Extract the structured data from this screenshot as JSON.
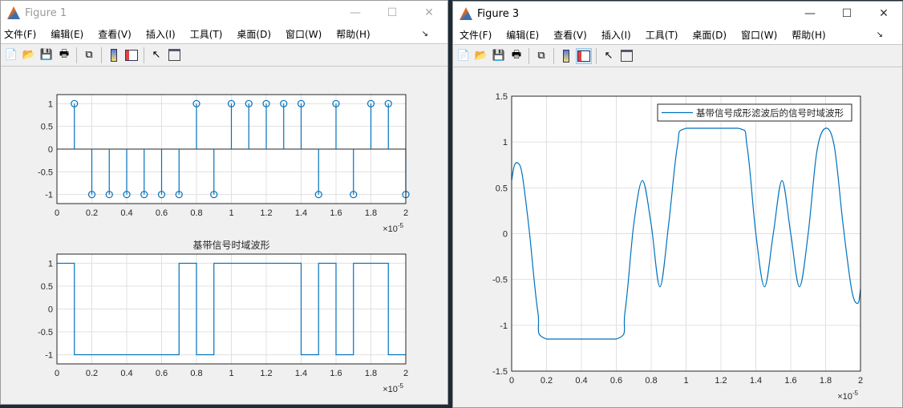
{
  "figure1": {
    "title": "Figure 1",
    "window_buttons": [
      "—",
      "☐",
      "✕"
    ],
    "menu": [
      "文件(F)",
      "编辑(E)",
      "查看(V)",
      "插入(I)",
      "工具(T)",
      "桌面(D)",
      "窗口(W)",
      "帮助(H)"
    ],
    "toolbar": [
      "new-icon",
      "open-icon",
      "save-icon",
      "print-icon",
      "link-icon",
      "colorbar-icon",
      "legend-icon",
      "pointer-icon",
      "property-editor-icon"
    ]
  },
  "figure3": {
    "title": "Figure 3",
    "window_buttons": [
      "—",
      "☐",
      "✕"
    ],
    "menu": [
      "文件(F)",
      "编辑(E)",
      "查看(V)",
      "插入(I)",
      "工具(T)",
      "桌面(D)",
      "窗口(W)",
      "帮助(H)"
    ],
    "toolbar": [
      "new-icon",
      "open-icon",
      "save-icon",
      "print-icon",
      "link-icon",
      "colorbar-icon",
      "legend-icon",
      "pointer-icon",
      "property-editor-icon"
    ]
  },
  "chart_data": [
    {
      "type": "stem",
      "title": "",
      "x": [
        0.1,
        0.2,
        0.3,
        0.4,
        0.5,
        0.6,
        0.7,
        0.8,
        0.9,
        1.0,
        1.1,
        1.2,
        1.3,
        1.4,
        1.5,
        1.6,
        1.7,
        1.8,
        1.9,
        2.0
      ],
      "y": [
        1,
        -1,
        -1,
        -1,
        -1,
        -1,
        -1,
        1,
        -1,
        1,
        1,
        1,
        1,
        1,
        -1,
        1,
        -1,
        1,
        1,
        -1
      ],
      "xlim": [
        0,
        2
      ],
      "ylim": [
        -1.2,
        1.2
      ],
      "xticks": [
        "0",
        "0.2",
        "0.4",
        "0.6",
        "0.8",
        "1",
        "1.2",
        "1.4",
        "1.6",
        "1.8",
        "2"
      ],
      "yticks": [
        "-1",
        "-0.5",
        "0",
        "0.5",
        "1"
      ],
      "xexp": "×10",
      "xexp_power": "-5",
      "grid": true,
      "color": "#0072bd"
    },
    {
      "type": "line",
      "title": "基带信号时域波形",
      "x": [
        0,
        0.1,
        0.1,
        0.7,
        0.7,
        0.8,
        0.8,
        0.9,
        0.9,
        1.4,
        1.4,
        1.5,
        1.5,
        1.6,
        1.6,
        1.7,
        1.7,
        1.9,
        1.9,
        2.0
      ],
      "y": [
        1,
        1,
        -1,
        -1,
        1,
        1,
        -1,
        -1,
        1,
        1,
        -1,
        -1,
        1,
        1,
        -1,
        -1,
        1,
        1,
        -1,
        -1
      ],
      "xlim": [
        0,
        2
      ],
      "ylim": [
        -1.2,
        1.2
      ],
      "xticks": [
        "0",
        "0.2",
        "0.4",
        "0.6",
        "0.8",
        "1",
        "1.2",
        "1.4",
        "1.6",
        "1.8",
        "2"
      ],
      "yticks": [
        "-1",
        "-0.5",
        "0",
        "0.5",
        "1"
      ],
      "xexp": "×10",
      "xexp_power": "-5",
      "grid": true,
      "color": "#0072bd"
    },
    {
      "type": "line",
      "title": "",
      "legend": "基带信号成形滤波后的信号时域波形",
      "legend_position": "top-right",
      "x": [
        0,
        0.015,
        0.035,
        0.06,
        0.1,
        0.15,
        0.2,
        0.6,
        0.65,
        0.7,
        0.75,
        0.8,
        0.85,
        0.9,
        0.95,
        1.0,
        1.3,
        1.35,
        1.4,
        1.45,
        1.5,
        1.55,
        1.6,
        1.65,
        1.7,
        1.75,
        1.8,
        1.85,
        1.9,
        1.95,
        1.985,
        2.0
      ],
      "y": [
        0.58,
        0.74,
        0.77,
        0.65,
        0.05,
        -0.85,
        -1.15,
        -1.15,
        -0.85,
        0.1,
        0.58,
        0.1,
        -0.58,
        0.1,
        0.95,
        1.15,
        1.15,
        0.95,
        0.0,
        -0.58,
        0.0,
        0.58,
        0.0,
        -0.58,
        0.0,
        0.9,
        1.15,
        0.95,
        0.1,
        -0.62,
        -0.76,
        -0.6
      ],
      "xlim": [
        0,
        2
      ],
      "ylim": [
        -1.5,
        1.5
      ],
      "xticks": [
        "0",
        "0.2",
        "0.4",
        "0.6",
        "0.8",
        "1",
        "1.2",
        "1.4",
        "1.6",
        "1.8",
        "2"
      ],
      "yticks": [
        "-1.5",
        "-1",
        "-0.5",
        "0",
        "0.5",
        "1",
        "1.5"
      ],
      "xexp": "×10",
      "xexp_power": "-5",
      "grid": true,
      "color": "#0072bd"
    }
  ]
}
